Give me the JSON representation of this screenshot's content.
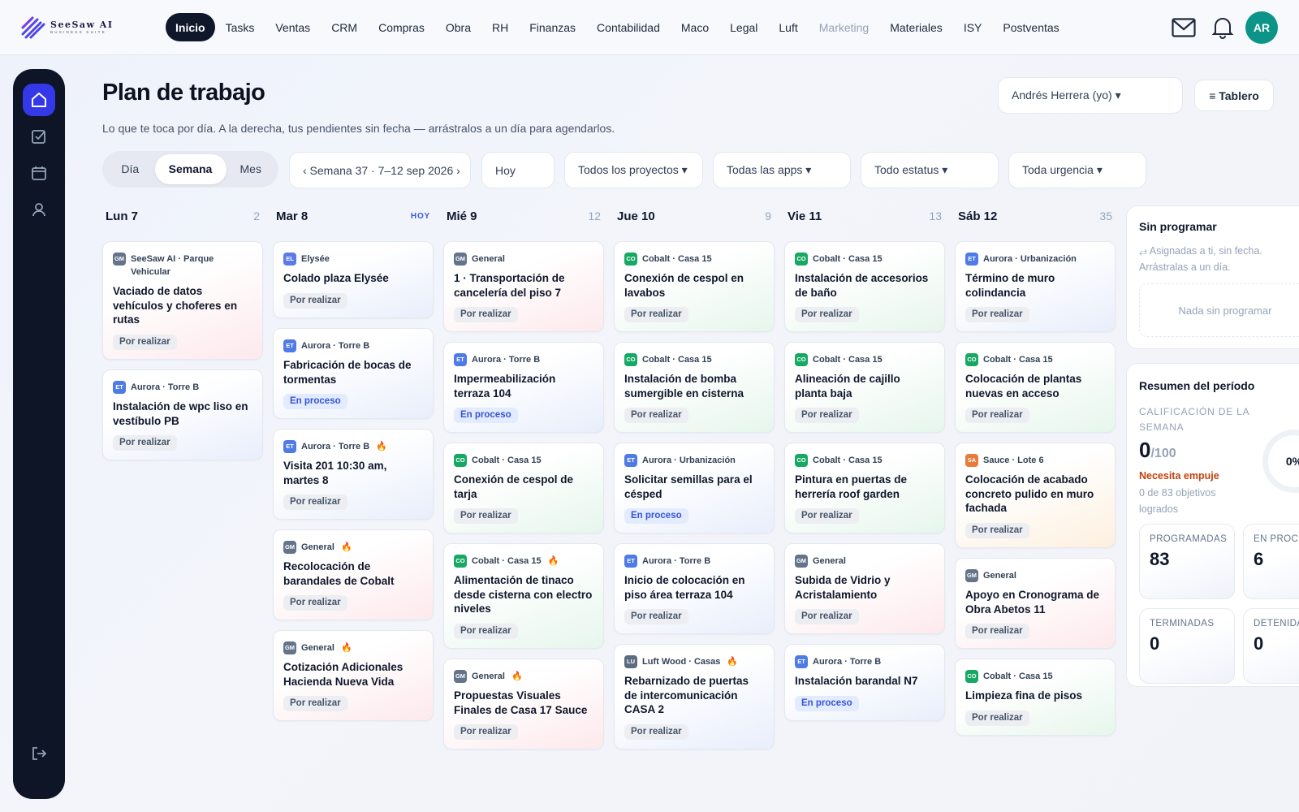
{
  "app": {
    "name": "SeeSaw AI",
    "subtitle": "BUSINESS SUITE"
  },
  "nav": [
    {
      "label": "Inicio",
      "active": true
    },
    {
      "label": "Tasks"
    },
    {
      "label": "Ventas"
    },
    {
      "label": "CRM"
    },
    {
      "label": "Compras"
    },
    {
      "label": "Obra"
    },
    {
      "label": "RH"
    },
    {
      "label": "Finanzas"
    },
    {
      "label": "Contabilidad"
    },
    {
      "label": "Maco"
    },
    {
      "label": "Legal"
    },
    {
      "label": "Luft"
    },
    {
      "label": "Marketing",
      "muted": true
    },
    {
      "label": "Materiales"
    },
    {
      "label": "ISY"
    },
    {
      "label": "Postventas"
    }
  ],
  "user": {
    "initials": "AR"
  },
  "page": {
    "title": "Plan de trabajo",
    "subtitle": "Lo que te toca por día. A la derecha, tus pendientes sin fecha — arrástralos a un día para agendarlos.",
    "user_select": "Andrés Herrera (yo) ▾",
    "board_button": "≡ Tablero"
  },
  "view_tabs": [
    "Día",
    "Semana",
    "Mes"
  ],
  "active_view": "Semana",
  "filters": {
    "week": "‹ Semana 37 · 7–12 sep 2026 ›",
    "today": "Hoy",
    "projects": "Todos los proyectos ▾",
    "apps": "Todas las apps ▾",
    "status": "Todo estatus ▾",
    "urgency": "Toda urgencia ▾"
  },
  "days": [
    {
      "label": "Lun 7",
      "count": "2",
      "cards": [
        {
          "badge": "GM",
          "project": "SeeSaw AI · Parque Vehicular",
          "title": "Vaciado de datos vehículos y choferes en rutas",
          "status": "Por realizar",
          "tone": "red"
        },
        {
          "badge": "ET",
          "project": "Aurora · Torre B",
          "title": "Instalación de wpc liso en vestíbulo PB",
          "status": "Por realizar",
          "tone": "blue"
        }
      ]
    },
    {
      "label": "Mar 8",
      "count": "HOY",
      "today": true,
      "cards": [
        {
          "badge": "EL",
          "project": "Elysée",
          "title": "Colado plaza Elysée",
          "status": "Por realizar",
          "tone": "blue"
        },
        {
          "badge": "ET",
          "project": "Aurora · Torre B",
          "title": "Fabricación de bocas de tormentas",
          "status": "En proceso",
          "tone": "blue"
        },
        {
          "badge": "ET",
          "project": "Aurora · Torre B",
          "fire": true,
          "title": "Visita 201 10:30 am, martes 8",
          "status": "Por realizar",
          "tone": "blue"
        },
        {
          "badge": "GM",
          "project": "General",
          "fire": true,
          "title": "Recolocación de barandales de Cobalt",
          "status": "Por realizar",
          "tone": "red"
        },
        {
          "badge": "GM",
          "project": "General",
          "fire": true,
          "title": "Cotización Adicionales Hacienda Nueva Vida",
          "status": "Por realizar",
          "tone": "red"
        }
      ]
    },
    {
      "label": "Mié 9",
      "count": "12",
      "cards": [
        {
          "badge": "GM",
          "project": "General",
          "title": "1 · Transportación de cancelería del piso 7",
          "status": "Por realizar",
          "tone": "red"
        },
        {
          "badge": "ET",
          "project": "Aurora · Torre B",
          "title": "Impermeabilización terraza 104",
          "status": "En proceso",
          "tone": "blue"
        },
        {
          "badge": "CO",
          "project": "Cobalt · Casa 15",
          "title": "Conexión de cespol de tarja",
          "status": "Por realizar",
          "tone": "green"
        },
        {
          "badge": "CO",
          "project": "Cobalt · Casa 15",
          "fire": true,
          "title": "Alimentación de tinaco desde cisterna con electro niveles",
          "status": "Por realizar",
          "tone": "green"
        },
        {
          "badge": "GM",
          "project": "General",
          "fire": true,
          "title": "Propuestas Visuales Finales de Casa 17 Sauce",
          "status": "Por realizar",
          "tone": "red"
        }
      ]
    },
    {
      "label": "Jue 10",
      "count": "9",
      "cards": [
        {
          "badge": "CO",
          "project": "Cobalt · Casa 15",
          "title": "Conexión de cespol en lavabos",
          "status": "Por realizar",
          "tone": "green"
        },
        {
          "badge": "CO",
          "project": "Cobalt · Casa 15",
          "title": "Instalación de bomba sumergible en cisterna",
          "status": "Por realizar",
          "tone": "green"
        },
        {
          "badge": "ET",
          "project": "Aurora · Urbanización",
          "title": "Solicitar semillas para el césped",
          "status": "En proceso",
          "tone": "blue"
        },
        {
          "badge": "ET",
          "project": "Aurora · Torre B",
          "title": "Inicio de colocación en piso área terraza 104",
          "status": "Por realizar",
          "tone": "blue"
        },
        {
          "badge": "LU",
          "project": "Luft Wood · Casas",
          "fire": true,
          "title": "Rebarnizado de puertas de intercomunicación CASA 2",
          "status": "Por realizar",
          "tone": "blue"
        }
      ]
    },
    {
      "label": "Vie 11",
      "count": "13",
      "cards": [
        {
          "badge": "CO",
          "project": "Cobalt · Casa 15",
          "title": "Instalación de accesorios de baño",
          "status": "Por realizar",
          "tone": "green"
        },
        {
          "badge": "CO",
          "project": "Cobalt · Casa 15",
          "title": "Alineación de cajillo planta baja",
          "status": "Por realizar",
          "tone": "green"
        },
        {
          "badge": "CO",
          "project": "Cobalt · Casa 15",
          "title": "Pintura en puertas de herrería roof garden",
          "status": "Por realizar",
          "tone": "green"
        },
        {
          "badge": "GM",
          "project": "General",
          "title": "Subida de Vidrio y Acristalamiento",
          "status": "Por realizar",
          "tone": "red"
        },
        {
          "badge": "ET",
          "project": "Aurora · Torre B",
          "title": "Instalación barandal N7",
          "status": "En proceso",
          "tone": "blue"
        }
      ]
    },
    {
      "label": "Sáb 12",
      "count": "35",
      "cards": [
        {
          "badge": "ET",
          "project": "Aurora · Urbanización",
          "title": "Término de muro colindancia",
          "status": "Por realizar",
          "tone": "blue"
        },
        {
          "badge": "CO",
          "project": "Cobalt · Casa 15",
          "title": "Colocación de plantas nuevas en acceso",
          "status": "Por realizar",
          "tone": "green"
        },
        {
          "badge": "SA",
          "project": "Sauce · Lote 6",
          "title": "Colocación de acabado concreto pulido en muro fachada",
          "status": "Por realizar",
          "tone": "orange"
        },
        {
          "badge": "GM",
          "project": "General",
          "title": "Apoyo en Cronograma de Obra Abetos 11",
          "status": "Por realizar",
          "tone": "red"
        },
        {
          "badge": "CO",
          "project": "Cobalt · Casa 15",
          "title": "Limpieza fina de pisos",
          "status": "Por realizar",
          "tone": "green"
        }
      ]
    }
  ],
  "unscheduled": {
    "title": "Sin programar",
    "hint": "⥄ Asignadas a ti, sin fecha. Arrástralas a un día.",
    "empty": "Nada sin programar"
  },
  "summary": {
    "title": "Resumen del período",
    "rating_label": "CALIFICACIÓN DE LA SEMANA",
    "score": "0",
    "score_max": "/100",
    "verdict": "Necesita empuje",
    "goals": "0 de 83 objetivos logrados",
    "percent": "0%",
    "percent_value": 0,
    "stats": [
      {
        "label": "PROGRAMADAS",
        "value": "83"
      },
      {
        "label": "EN PROCESO",
        "value": "6"
      },
      {
        "label": "TERMINADAS",
        "value": "0"
      },
      {
        "label": "DETENIDAS",
        "value": "0"
      }
    ]
  },
  "colors": {
    "accent": "#3538e6",
    "nav_active": "#0f172a",
    "avatar": "#0d9488",
    "verdict": "#c2410c",
    "in_progress": "#3654d8"
  }
}
